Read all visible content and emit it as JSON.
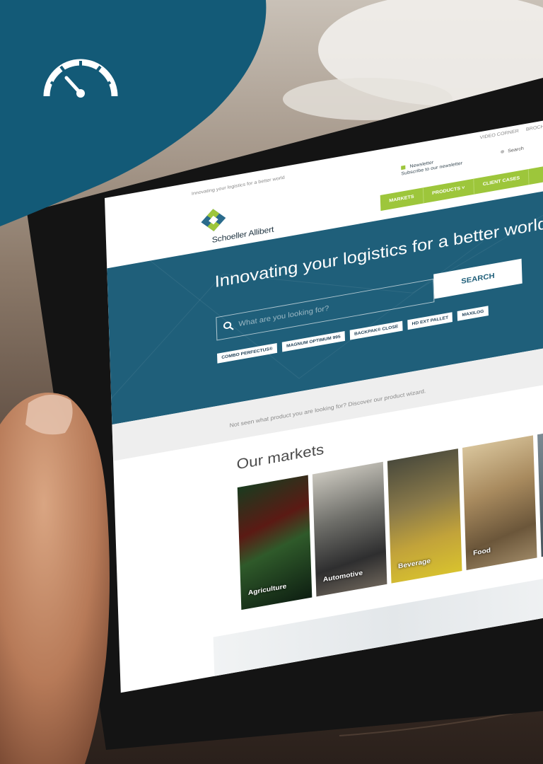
{
  "colors": {
    "badge": "#135a77",
    "hero": "#1f5f7a",
    "nav": "#9dc63b",
    "accent_green": "#9dc63b"
  },
  "badge_icon": "speedometer-icon",
  "site": {
    "tagline": "Innovating your logistics for a better world",
    "utility_links": [
      "VIDEO CORNER",
      "BROCHURES"
    ],
    "newsletter": {
      "title": "Newsletter",
      "label": "Subscribe to our newsletter"
    },
    "search_link": "Search",
    "brand": "Schoeller Allibert",
    "nav": [
      "MARKETS",
      "PRODUCTS ˅",
      "CLIENT CASES"
    ],
    "hero": {
      "headline": "Innovating your logistics for a better world.",
      "search_placeholder": "What are you looking for?",
      "search_button": "SEARCH",
      "tags": [
        "COMBO PERFECTUS®",
        "MAGNUM OPTIMUM 995",
        "BACKPAK® CLOSE",
        "HD EXT PALLET",
        "MAXILOG"
      ]
    },
    "wizard_text": "Not seen what product you are looking for? Discover our product wizard.",
    "markets": {
      "title": "Our markets",
      "tiles": [
        "Agriculture",
        "Automotive",
        "Beverage",
        "Food",
        ""
      ]
    }
  }
}
